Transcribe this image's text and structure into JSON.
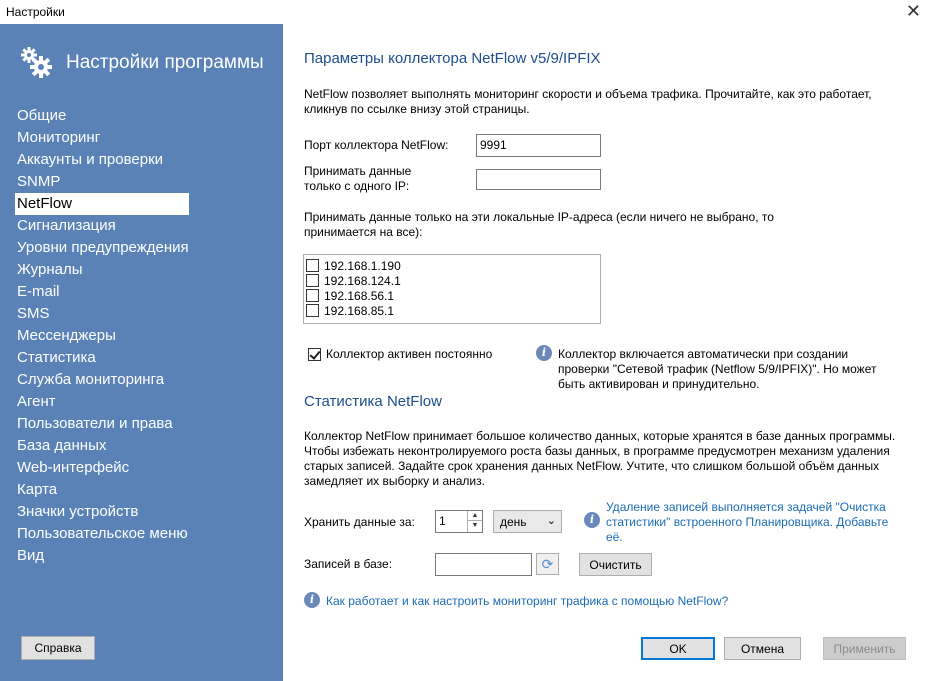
{
  "window": {
    "title": "Настройки",
    "close_glyph": "✕"
  },
  "sidebar": {
    "title": "Настройки программы",
    "icon": "gears-icon",
    "items": [
      {
        "label": "Общие"
      },
      {
        "label": "Мониторинг"
      },
      {
        "label": "Аккаунты и проверки"
      },
      {
        "label": "SNMP"
      },
      {
        "label": "NetFlow",
        "active": true
      },
      {
        "label": "Сигнализация"
      },
      {
        "label": "Уровни предупреждения"
      },
      {
        "label": "Журналы"
      },
      {
        "label": "E-mail"
      },
      {
        "label": "SMS"
      },
      {
        "label": "Мессенджеры"
      },
      {
        "label": "Статистика"
      },
      {
        "label": "Служба мониторинга"
      },
      {
        "label": "Агент"
      },
      {
        "label": "Пользователи и права"
      },
      {
        "label": "База данных"
      },
      {
        "label": "Web-интерфейс"
      },
      {
        "label": "Карта"
      },
      {
        "label": "Значки устройств"
      },
      {
        "label": "Пользовательское меню"
      },
      {
        "label": "Вид"
      }
    ],
    "help_button": "Справка"
  },
  "collector": {
    "heading": "Параметры коллектора NetFlow v5/9/IPFIX",
    "intro_line1": "NetFlow позволяет выполнять мониторинг скорости и объема трафика.  Прочитайте, как это работает,",
    "intro_line2": "кликнув по ссылке внизу этой страницы.",
    "port_label": "Порт коллектора NetFlow:",
    "port_value": "9991",
    "single_ip_label_line1": "Принимать данные",
    "single_ip_label_line2": "только с одного IP:",
    "single_ip_value": "",
    "local_ips_label_line1": "Принимать данные только на эти локальные IP-адреса (если ничего не выбрано, то",
    "local_ips_label_line2": "принимается на все):",
    "local_ips": [
      {
        "ip": "192.168.1.190",
        "checked": false
      },
      {
        "ip": "192.168.124.1",
        "checked": false
      },
      {
        "ip": "192.168.56.1",
        "checked": false
      },
      {
        "ip": "192.168.85.1",
        "checked": false
      }
    ],
    "always_active_label": "Коллектор активен постоянно",
    "always_active_checked": true,
    "info_line1": "Коллектор включается автоматически при создании",
    "info_line2": "проверки \"Сетевой трафик (Netflow 5/9/IPFIX)\". Но может",
    "info_line3": "быть активирован и принудительно."
  },
  "stats": {
    "heading": "Статистика NetFlow",
    "desc_line1": "Коллектор NetFlow принимает большое количество данных, которые хранятся в базе данных программы.",
    "desc_line2": "Чтобы избежать неконтролируемого роста базы данных, в программе предусмотрен механизм удаления",
    "desc_line3": "старых записей. Задайте срок хранения данных NetFlow. Учтите, что слишком большой объём данных",
    "desc_line4": "замедляет их выборку и анализ.",
    "keep_label": "Хранить данные за:",
    "keep_value": "1",
    "keep_unit": "день",
    "cleanup_info_line1": "Удаление записей выполняется задачей \"Очистка",
    "cleanup_info_line2": "статистики\" встроенного Планировщика. Добавьте",
    "cleanup_info_line3": "её.",
    "records_label": "Записей в базе:",
    "records_value": "",
    "clear_button": "Очистить",
    "help_link": "Как работает и как настроить мониторинг трафика с помощью NetFlow?"
  },
  "footer": {
    "ok": "OK",
    "cancel": "Отмена",
    "apply": "Применить"
  },
  "colors": {
    "sidebar_bg": "#5a82b7",
    "heading": "#1e4e8c",
    "link": "#1c6bb5"
  }
}
